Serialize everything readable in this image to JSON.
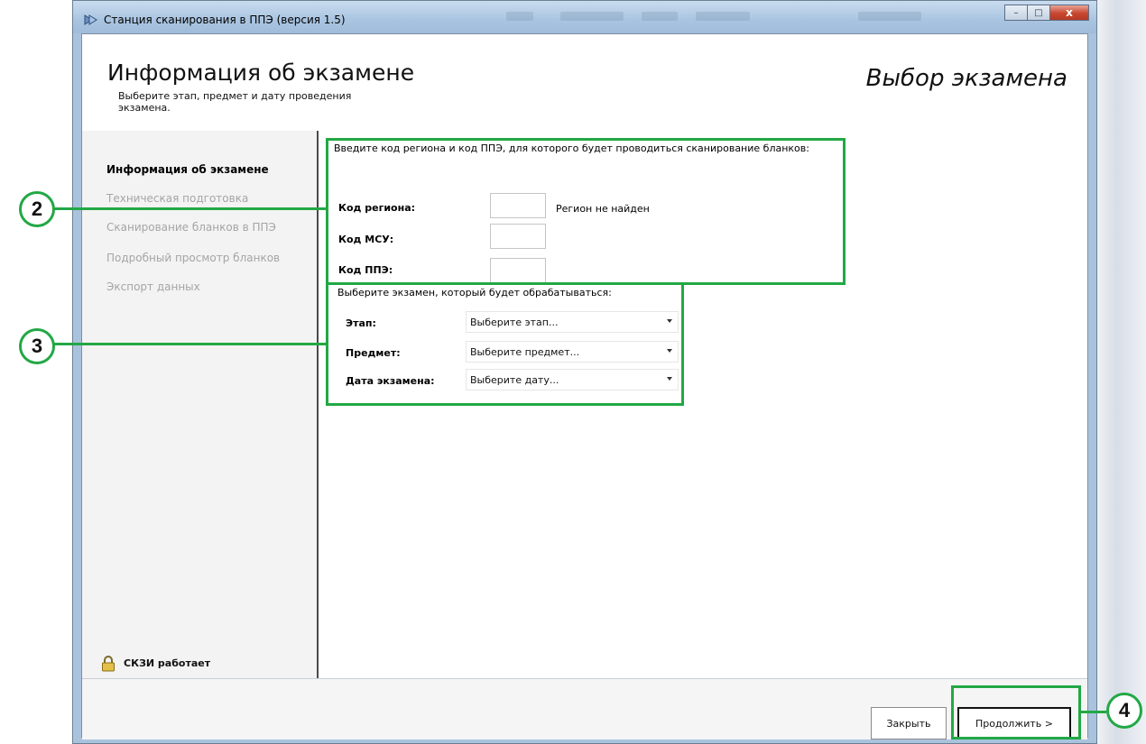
{
  "window": {
    "title": "Станция сканирования в ППЭ (версия 1.5)",
    "min_symbol": "–",
    "max_symbol": "□",
    "close_symbol": "x"
  },
  "header": {
    "title": "Информация об экзамене",
    "subtitle": "Выберите этап, предмет и дату проведения экзамена.",
    "right_title": "Выбор экзамена"
  },
  "sidebar": {
    "items": [
      {
        "label": "Информация об экзамене",
        "active": true
      },
      {
        "label": "Техническая подготовка",
        "active": false
      },
      {
        "label": "Сканирование бланков в ППЭ",
        "active": false
      },
      {
        "label": "Подробный просмотр бланков",
        "active": false
      },
      {
        "label": "Экспорт данных",
        "active": false
      }
    ],
    "status_label": "СКЗИ работает"
  },
  "region_section": {
    "intro": "Введите код региона и код ППЭ, для которого будет проводиться сканирование бланков:",
    "region_code_label": "Код региона:",
    "region_code_value": "",
    "region_status": "Регион не найден",
    "msu_code_label": "Код МСУ:",
    "msu_code_value": "",
    "ppe_code_label": "Код ППЭ:",
    "ppe_code_value": ""
  },
  "exam_section": {
    "intro": "Выберите экзамен, который будет обрабатываться:",
    "stage_label": "Этап:",
    "stage_value": "Выберите этап...",
    "subject_label": "Предмет:",
    "subject_value": "Выберите предмет...",
    "date_label": "Дата экзамена:",
    "date_value": "Выберите дату..."
  },
  "footer": {
    "close_label": "Закрыть",
    "continue_label": "Продолжить >"
  },
  "callouts": {
    "region": "2",
    "exam": "3",
    "continue": "4"
  },
  "colors": {
    "callout_green": "#22a845"
  }
}
